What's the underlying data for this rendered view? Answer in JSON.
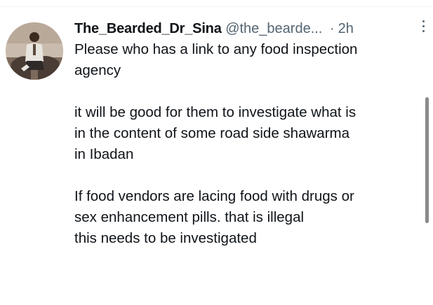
{
  "tweet": {
    "author": {
      "display_name": "The_Bearded_Dr_Sina",
      "handle": "@the_bearde...",
      "separator": "·",
      "time": "2h",
      "avatar_icon": "profile-photo"
    },
    "more_icon": "more-vertical-icon",
    "paragraphs": [
      {
        "lines": [
          "Please who has a link to any food inspection",
          "agency"
        ]
      },
      {
        "lines": [
          "it will be good for them to investigate what is",
          "in the content of some road side shawarma",
          "in Ibadan"
        ]
      },
      {
        "lines": [
          "If food vendors are lacing food with drugs or",
          "sex enhancement pills. that is illegal",
          "this needs to be investigated"
        ]
      }
    ]
  },
  "colors": {
    "text_primary": "#0f1419",
    "text_secondary": "#536471",
    "divider": "#eff3f4",
    "scrollbar": "#8a8a8a"
  }
}
